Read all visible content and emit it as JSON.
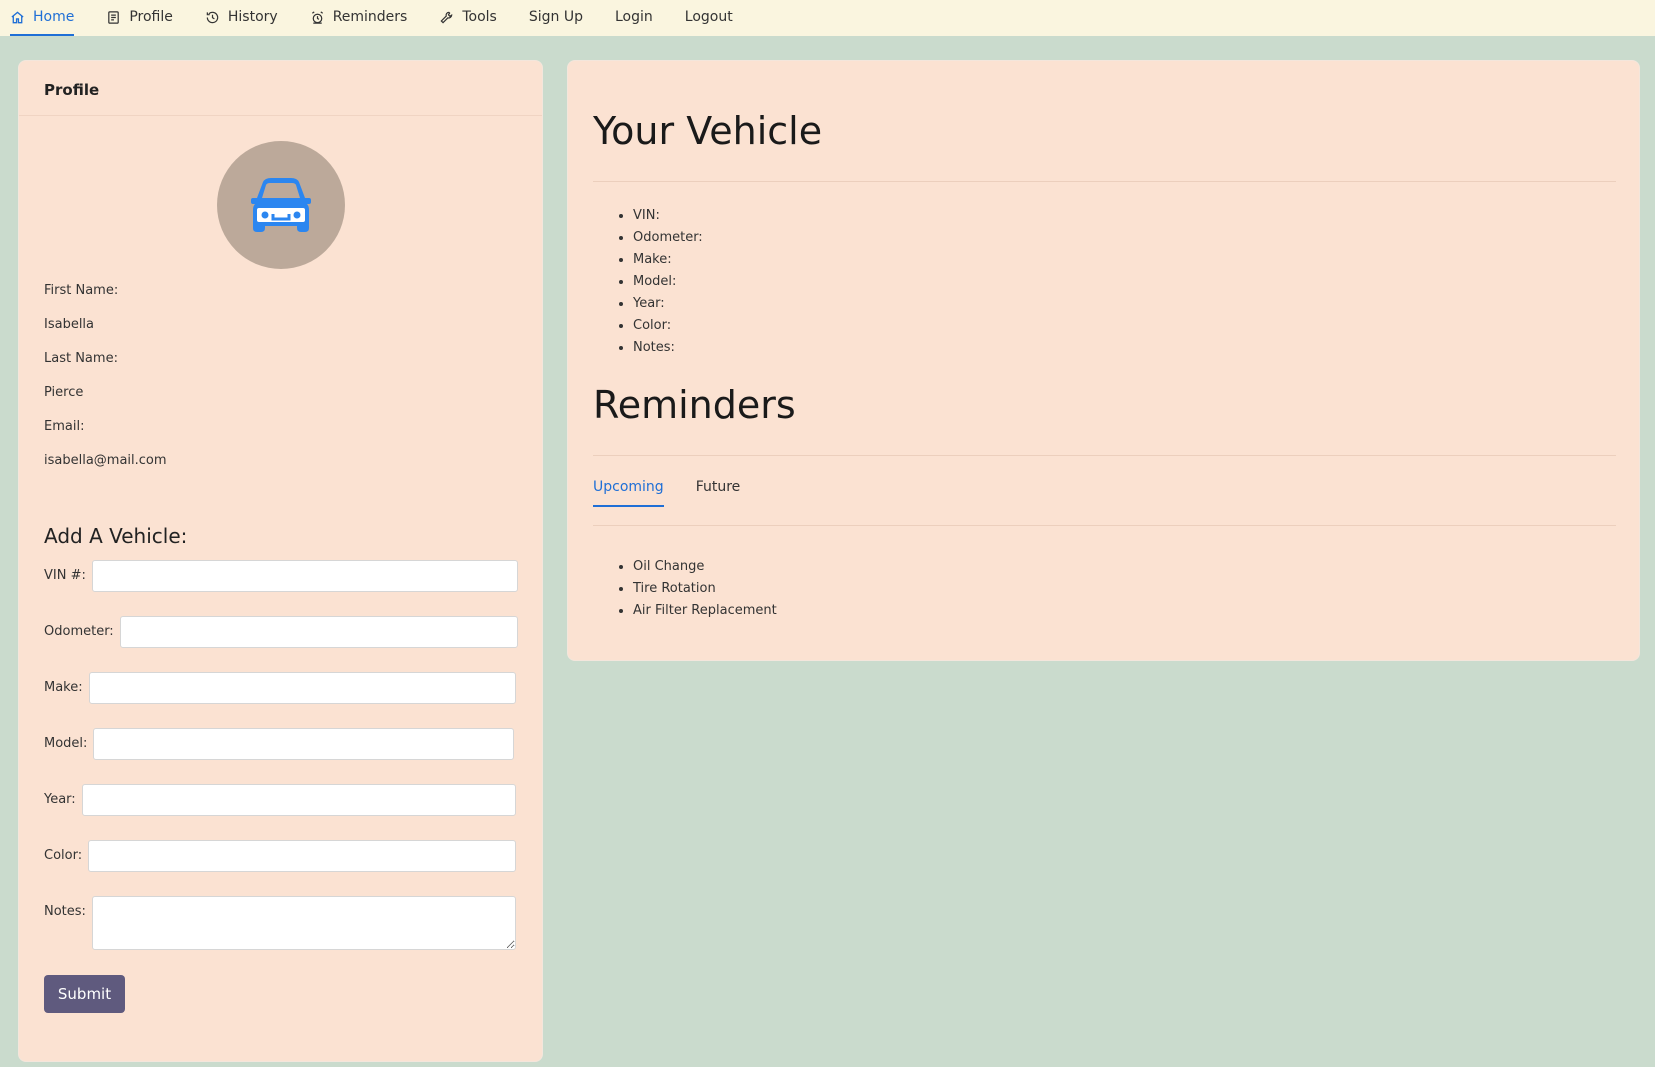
{
  "nav": {
    "items": [
      {
        "label": "Home",
        "icon": "home-icon"
      },
      {
        "label": "Profile",
        "icon": "profile-icon"
      },
      {
        "label": "History",
        "icon": "history-icon"
      },
      {
        "label": "Reminders",
        "icon": "alarm-icon"
      },
      {
        "label": "Tools",
        "icon": "wrench-icon"
      },
      {
        "label": "Sign Up"
      },
      {
        "label": "Login"
      },
      {
        "label": "Logout"
      }
    ],
    "active": "Home"
  },
  "profile": {
    "title": "Profile",
    "avatar_icon": "car-icon",
    "first_name_label": "First Name:",
    "first_name": "Isabella",
    "last_name_label": "Last Name:",
    "last_name": "Pierce",
    "email_label": "Email:",
    "email": "isabella@mail.com"
  },
  "add_vehicle": {
    "title": "Add A Vehicle:",
    "fields": {
      "vin": {
        "label": "VIN #:",
        "value": ""
      },
      "odometer": {
        "label": "Odometer:",
        "value": ""
      },
      "make": {
        "label": "Make:",
        "value": ""
      },
      "model": {
        "label": "Model:",
        "value": ""
      },
      "year": {
        "label": "Year:",
        "value": ""
      },
      "color": {
        "label": "Color:",
        "value": ""
      },
      "notes": {
        "label": "Notes:",
        "value": ""
      }
    },
    "submit_label": "Submit"
  },
  "vehicle": {
    "title": "Your Vehicle",
    "details": [
      "VIN:",
      "Odometer:",
      "Make:",
      "Model:",
      "Year:",
      "Color:",
      "Notes:"
    ]
  },
  "reminders": {
    "title": "Reminders",
    "tabs": [
      "Upcoming",
      "Future"
    ],
    "active_tab": "Upcoming",
    "items": [
      "Oil Change",
      "Tire Rotation",
      "Air Filter Replacement"
    ]
  },
  "colors": {
    "accent": "#1f6fd6",
    "card_bg": "#fbe2d2",
    "page_bg": "#cadbcd",
    "nav_bg": "#faf5df",
    "button_bg": "#5f5a7e",
    "avatar_bg": "#bca99a"
  }
}
